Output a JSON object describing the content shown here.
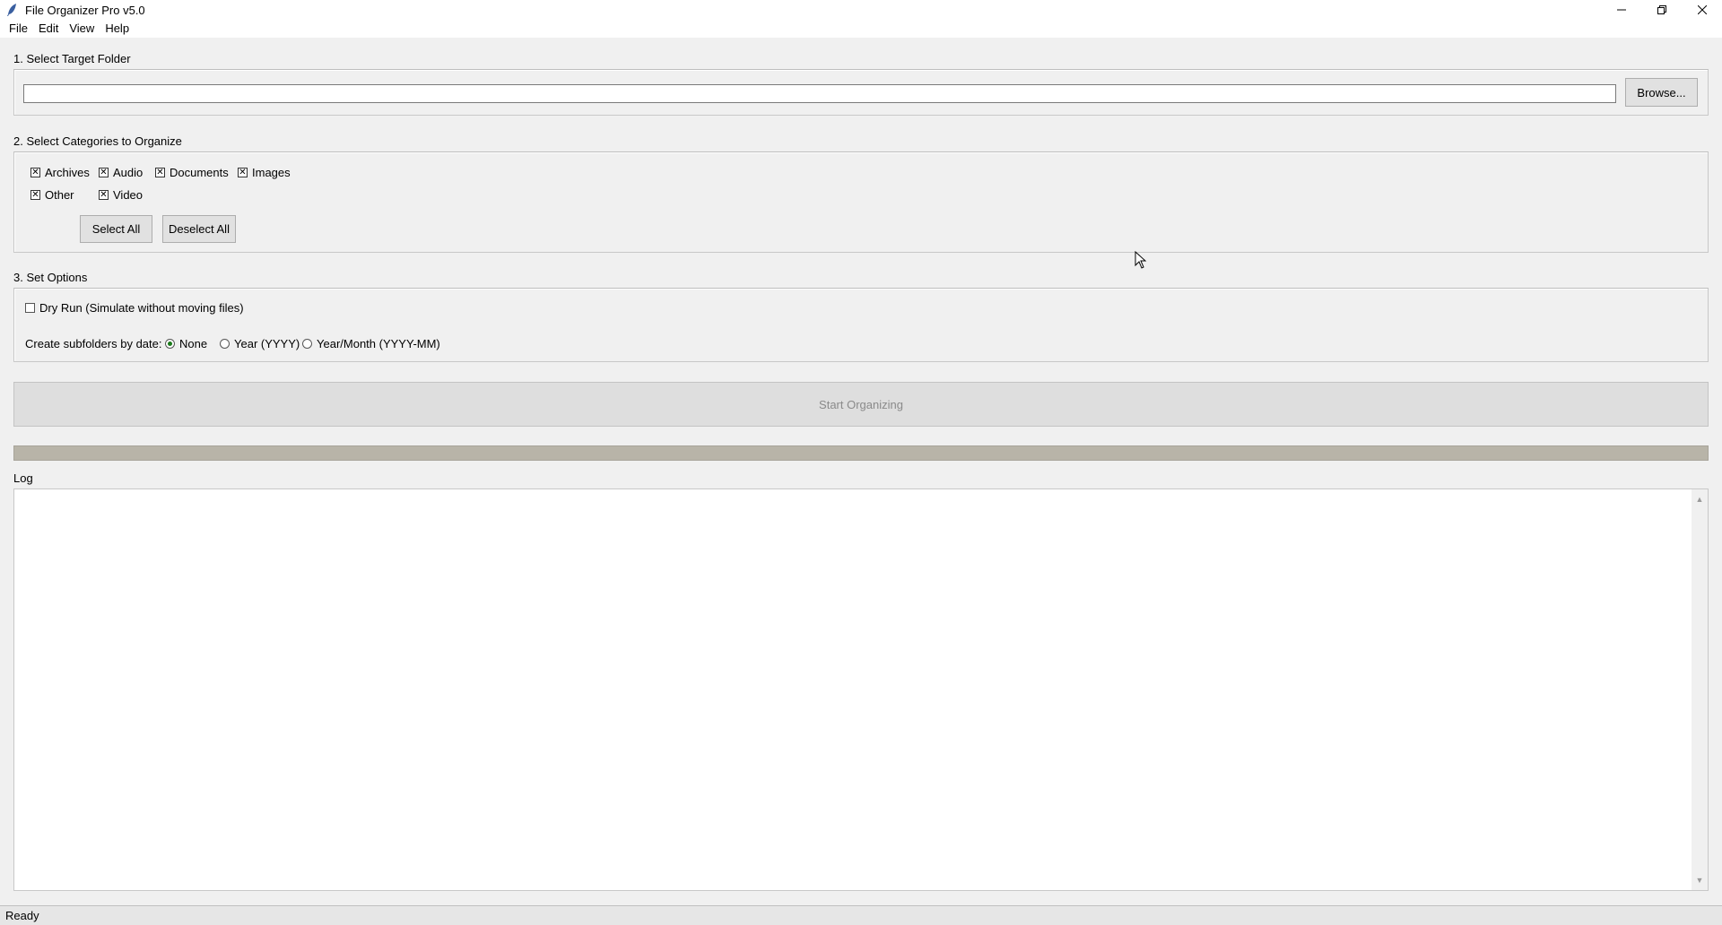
{
  "window": {
    "title": "File Organizer Pro v5.0",
    "icon": "feather-icon",
    "controls": [
      "minimize-icon",
      "maximize-icon",
      "close-icon"
    ]
  },
  "menu": [
    "File",
    "Edit",
    "View",
    "Help"
  ],
  "section1": {
    "label": "1. Select Target Folder",
    "path_value": "",
    "browse_label": "Browse..."
  },
  "section2": {
    "label": "2. Select Categories to Organize",
    "categories": [
      {
        "label": "Archives",
        "checked": true
      },
      {
        "label": "Audio",
        "checked": true
      },
      {
        "label": "Documents",
        "checked": true
      },
      {
        "label": "Images",
        "checked": true
      },
      {
        "label": "Other",
        "checked": true
      },
      {
        "label": "Video",
        "checked": true
      }
    ],
    "select_all_label": "Select All",
    "deselect_all_label": "Deselect All"
  },
  "section3": {
    "label": "3. Set Options",
    "dry_run_label": "Dry Run (Simulate without moving files)",
    "dry_run_checked": false,
    "subfolder_label": "Create subfolders by date:",
    "subfolder_options": [
      {
        "label": "None",
        "selected": true
      },
      {
        "label": "Year (YYYY)",
        "selected": false
      },
      {
        "label": "Year/Month (YYYY-MM)",
        "selected": false
      }
    ]
  },
  "start_label": "Start Organizing",
  "progress": 0,
  "log": {
    "label": "Log",
    "content": ""
  },
  "status": "Ready",
  "colors": {
    "window_bg": "#f0f0f0",
    "progress_trough": "#b8b4a8",
    "radio_selected": "#1a7a1a",
    "disabled_text": "#8a8a8a"
  }
}
